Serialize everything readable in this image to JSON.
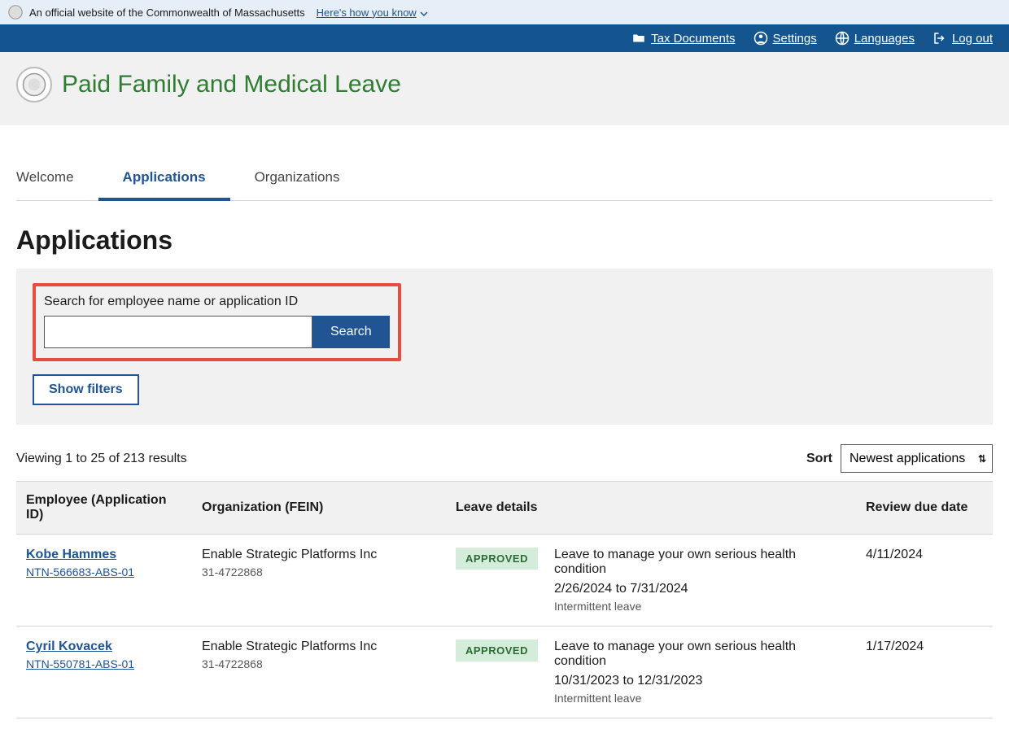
{
  "gov_banner": {
    "text": "An official website of the Commonwealth of Massachusetts",
    "how_link": "Here's how you know"
  },
  "topnav": {
    "tax_documents": "Tax Documents",
    "settings": "Settings",
    "languages": "Languages",
    "logout": "Log out"
  },
  "brand_title": "Paid Family and Medical Leave",
  "tabs": {
    "welcome": "Welcome",
    "applications": "Applications",
    "organizations": "Organizations",
    "active": "applications"
  },
  "page_title": "Applications",
  "search": {
    "label": "Search for employee name or application ID",
    "value": "",
    "button": "Search"
  },
  "show_filters": "Show filters",
  "results_summary": "Viewing 1 to 25 of 213 results",
  "sort": {
    "label": "Sort",
    "selected": "Newest applications"
  },
  "columns": {
    "employee": "Employee (Application ID)",
    "organization": "Organization (FEIN)",
    "leave": "Leave details",
    "due": "Review due date"
  },
  "rows": [
    {
      "name": "Kobe Hammes",
      "app_id": "NTN-566683-ABS-01",
      "org": "Enable Strategic Platforms Inc",
      "fein": "31-4722868",
      "status": "APPROVED",
      "reason": "Leave to manage your own serious health condition",
      "dates": "2/26/2024 to 7/31/2024",
      "pattern": "Intermittent leave",
      "due": "4/11/2024"
    },
    {
      "name": "Cyril Kovacek",
      "app_id": "NTN-550781-ABS-01",
      "org": "Enable Strategic Platforms Inc",
      "fein": "31-4722868",
      "status": "APPROVED",
      "reason": "Leave to manage your own serious health condition",
      "dates": "10/31/2023 to 12/31/2023",
      "pattern": "Intermittent leave",
      "due": "1/17/2024"
    }
  ]
}
